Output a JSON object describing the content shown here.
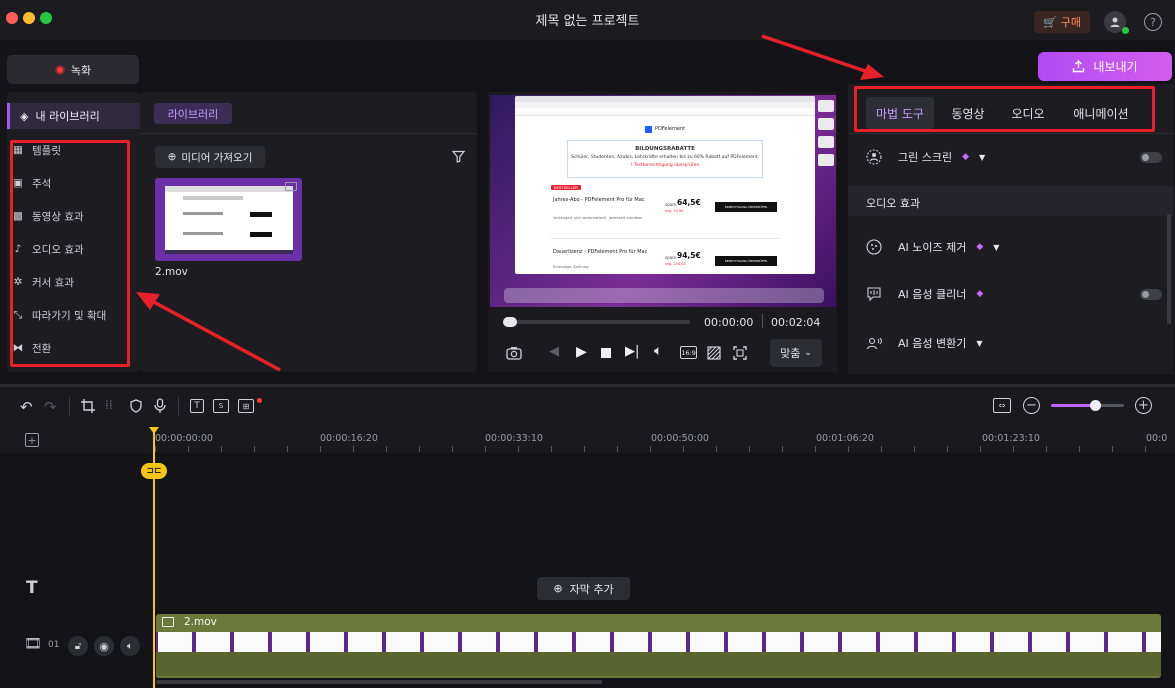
{
  "window": {
    "title": "제목 없는 프로젝트",
    "buy_label": "구매"
  },
  "record_label": "녹화",
  "export_label": "내보내기",
  "left_nav": {
    "header": "내 라이브러리",
    "items": [
      "템플릿",
      "주석",
      "동영상 효과",
      "오디오 효과",
      "커서 효과",
      "따라가기 및 확대",
      "전환"
    ]
  },
  "library": {
    "tab": "라이브러리",
    "import_label": "미디어 가져오기",
    "clip_name": "2.mov"
  },
  "preview": {
    "current_time": "00:00:00",
    "total_time": "00:02:04",
    "fit_label": "맞춤",
    "aspect": "16:9",
    "progress": 0.0,
    "inner_page": {
      "brand": "PDFelement",
      "banner_title": "BILDUNGSRABATTE",
      "banner_text": "Schüler, Studenten, Azubis, Lehrkräfte erhalten bis zu 60% Rabatt auf PDFelement.",
      "banner_link": "! Testberechtigung überprüfen",
      "badge": "BESTSELLER",
      "plan1_name": "Jahres-Abo - PDFelement Pro für Mac",
      "plan1_desc": "Verlängert sich automatisch, jederzeit kündbar",
      "plan1_price": "64,5€",
      "plan1_prefix": "spare",
      "plan1_old": "reg. 74,00",
      "plan2_name": "Dauerlizenz - PDFelement Pro für Mac",
      "plan2_desc": "Einmalige Zahlung",
      "plan2_price": "94,5€",
      "plan2_prefix": "spare",
      "plan2_old": "reg. 144,00",
      "cta": "BERECHTIGUNG ÜBERPRÜFEN"
    }
  },
  "right_panel": {
    "tabs": [
      "마법 도구",
      "동영상",
      "오디오",
      "애니메이션"
    ],
    "green_screen": "그린 스크린",
    "section_audio": "오디오 효과",
    "ai_noise": "AI 노이즈 제거",
    "ai_voice_cleaner": "AI 음성 클리너",
    "ai_voice_changer": "AI 음성 변환기",
    "green_screen_on": false,
    "voice_cleaner_on": false
  },
  "timeline": {
    "ticks": [
      "00:00:00:00",
      "00:00:16:20",
      "00:00:33:10",
      "00:00:50:00",
      "00:01:06:20",
      "00:01:23:10",
      "00:0"
    ],
    "add_caption": "자막 추가",
    "track_number": "01",
    "clip_label": "2.mov",
    "zoom_level": 0.6
  },
  "colors": {
    "accent": "#a855f7",
    "annotation": "#e8202a",
    "playhead": "#f5c518",
    "clip": "#6b7a3a"
  }
}
